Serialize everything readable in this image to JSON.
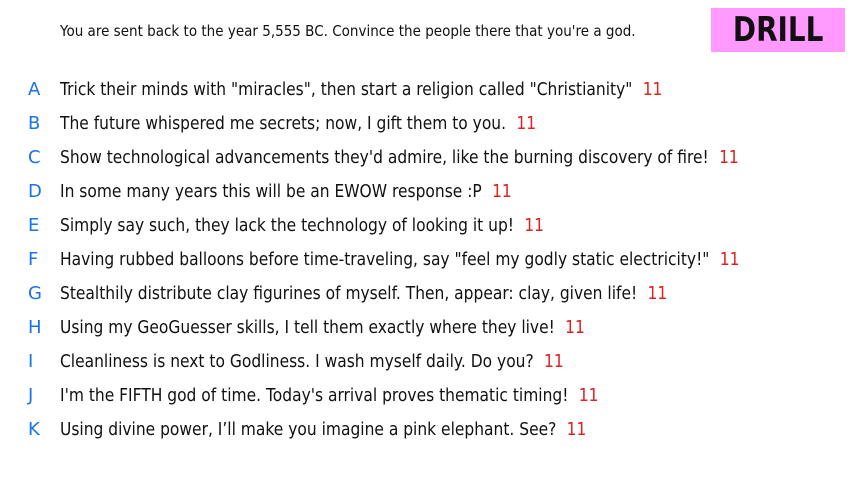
{
  "prompt": "You are sent back to the year 5,555 BC. Convince the people there that you're a god.",
  "badge": "DRILL",
  "colors": {
    "badge_bg": "#ff99ff",
    "letter": "#1a73e8",
    "score": "#e02020"
  },
  "responses": [
    {
      "letter": "A",
      "text": "Trick their minds with \"miracles\", then start a religion called \"Christianity\"",
      "score": "11"
    },
    {
      "letter": "B",
      "text": "The future whispered me secrets; now, I gift them to you.",
      "score": "11"
    },
    {
      "letter": "C",
      "text": "Show technological advancements they'd admire, like the burning discovery of fire!",
      "score": "11"
    },
    {
      "letter": "D",
      "text": "In some many years this will be an EWOW response :P",
      "score": "11"
    },
    {
      "letter": "E",
      "text": "Simply say such, they lack the technology of looking it up!",
      "score": "11"
    },
    {
      "letter": "F",
      "text": "Having rubbed balloons before time-traveling, say \"feel my godly static electricity!\"",
      "score": "11"
    },
    {
      "letter": "G",
      "text": "Stealthily distribute clay figurines of myself. Then, appear: clay, given life!",
      "score": "11"
    },
    {
      "letter": "H",
      "text": "Using my GeoGuesser skills, I tell them exactly where they live!",
      "score": "11"
    },
    {
      "letter": "I",
      "text": "Cleanliness is next to Godliness. I wash myself daily. Do you?",
      "score": "11"
    },
    {
      "letter": "J",
      "text": "I'm the FIFTH god of time. Today's arrival proves thematic timing!",
      "score": "11"
    },
    {
      "letter": "K",
      "text": "Using divine power, I’ll make you imagine a pink elephant. See?",
      "score": "11"
    }
  ]
}
